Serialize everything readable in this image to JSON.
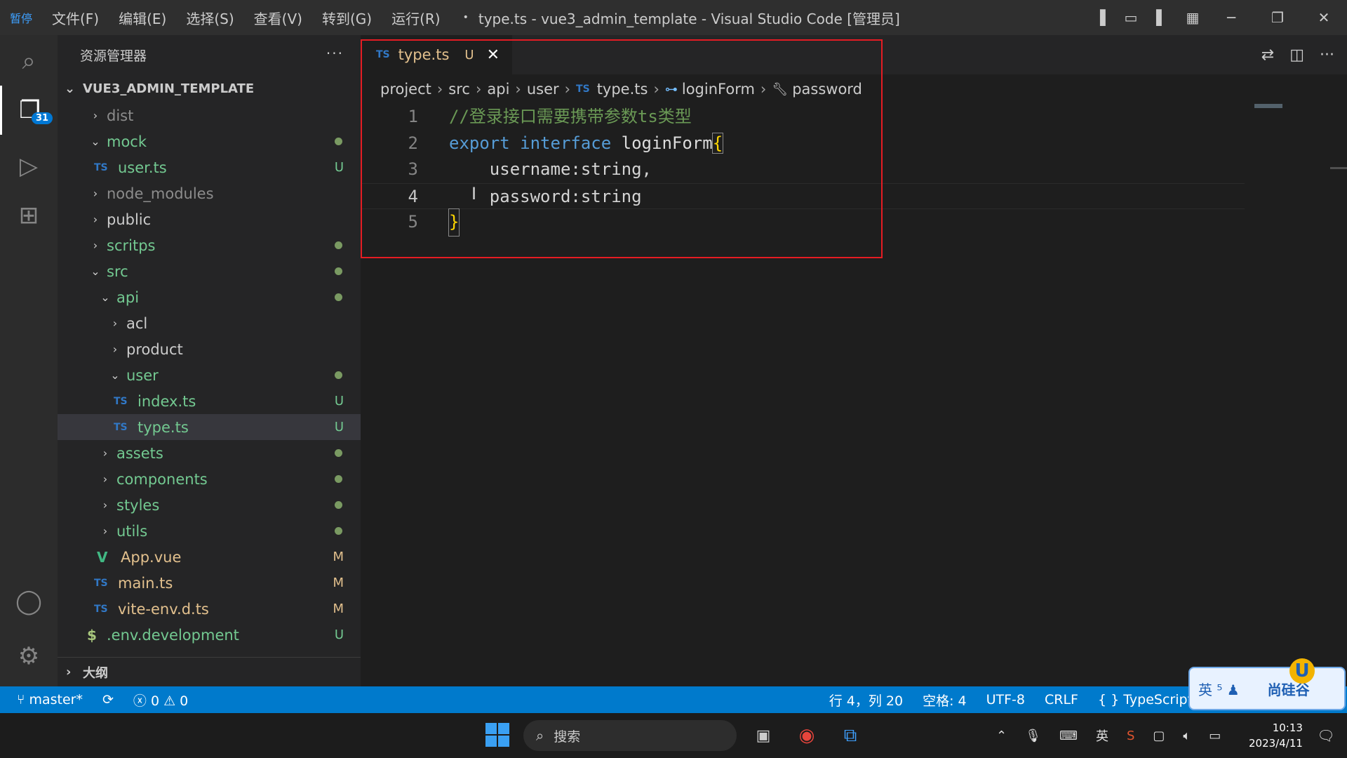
{
  "titlebar": {
    "app_logo_text": "暂停",
    "menu": [
      "文件(F)",
      "编辑(E)",
      "选择(S)",
      "查看(V)",
      "转到(G)",
      "运行(R)"
    ],
    "dot": "•",
    "window_title": "type.ts - vue3_admin_template - Visual Studio Code [管理员]"
  },
  "activitybar": {
    "explorer_badge": "31"
  },
  "sidebar": {
    "title": "资源管理器",
    "more": "···",
    "root": "VUE3_ADMIN_TEMPLATE",
    "outline": "大纲",
    "tree": [
      {
        "label": "dist",
        "chevron": "›",
        "status": ""
      },
      {
        "label": "mock",
        "chevron": "⌄",
        "status": "dot"
      },
      {
        "label": "user.ts",
        "chevron": "",
        "status": "U",
        "ts": "TS"
      },
      {
        "label": "node_modules",
        "chevron": "›",
        "status": ""
      },
      {
        "label": "public",
        "chevron": "›",
        "status": ""
      },
      {
        "label": "scritps",
        "chevron": "›",
        "status": "dot"
      },
      {
        "label": "src",
        "chevron": "⌄",
        "status": "dot"
      },
      {
        "label": "api",
        "chevron": "⌄",
        "status": "dot"
      },
      {
        "label": "acl",
        "chevron": "›",
        "status": ""
      },
      {
        "label": "product",
        "chevron": "›",
        "status": ""
      },
      {
        "label": "user",
        "chevron": "⌄",
        "status": "dot"
      },
      {
        "label": "index.ts",
        "chevron": "",
        "status": "U",
        "ts": "TS"
      },
      {
        "label": "type.ts",
        "chevron": "",
        "status": "U",
        "ts": "TS"
      },
      {
        "label": "assets",
        "chevron": "›",
        "status": "dot"
      },
      {
        "label": "components",
        "chevron": "›",
        "status": "dot"
      },
      {
        "label": "styles",
        "chevron": "›",
        "status": "dot"
      },
      {
        "label": "utils",
        "chevron": "›",
        "status": "dot"
      },
      {
        "label": "App.vue",
        "chevron": "",
        "status": "M",
        "icon": "V"
      },
      {
        "label": "main.ts",
        "chevron": "",
        "status": "M",
        "ts": "TS"
      },
      {
        "label": "vite-env.d.ts",
        "chevron": "",
        "status": "M",
        "ts": "TS"
      },
      {
        "label": ".env.development",
        "chevron": "",
        "status": "U",
        "icon": "$"
      }
    ]
  },
  "editor": {
    "tab": {
      "icon": "TS",
      "name": "type.ts",
      "status": "U",
      "close": "✕"
    },
    "breadcrumb": {
      "project": "project",
      "src": "src",
      "api": "api",
      "user": "user",
      "file": "type.ts",
      "interface": "loginForm",
      "property": "password"
    },
    "lines": [
      {
        "n": "1",
        "comment": "//登录接口需要携带参数ts类型"
      },
      {
        "n": "2",
        "kw1": "export",
        "kw2": "interface",
        "name": "loginForm",
        "brace": "{"
      },
      {
        "n": "3",
        "text": "    username:string,"
      },
      {
        "n": "4",
        "text": "    password:string"
      },
      {
        "n": "5",
        "brace": "}"
      }
    ]
  },
  "statusbar": {
    "branch": "master*",
    "errors": "0",
    "warnings": "0",
    "position": "行 4，列 20",
    "spaces": "空格: 4",
    "encoding": "UTF-8",
    "eol": "CRLF",
    "language": "TypeScript"
  },
  "taskbar": {
    "search": "搜索",
    "ime_lang": "英",
    "time": "10:13",
    "date": "2023/4/11"
  },
  "ime_widget": {
    "text": "英 ⁵ ♟",
    "brand": "尚硅谷",
    "badge": "U"
  }
}
